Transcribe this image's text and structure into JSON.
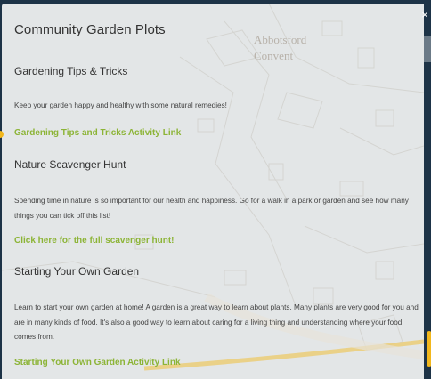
{
  "modal": {
    "title": "Community Garden Plots",
    "close_glyph": "×",
    "map_label": [
      "Abbotsford",
      "Convent"
    ]
  },
  "sections": [
    {
      "heading": "Gardening Tips & Tricks",
      "text": "Keep your garden happy and healthy with some natural remedies!",
      "link": "Gardening Tips and Tricks Activity Link"
    },
    {
      "heading": "Nature Scavenger Hunt",
      "text": "Spending time in nature is so important for our health and happiness. Go for a walk in a park or garden and see how many things you can tick off this list!",
      "link": "Click here for the full scavenger hunt!"
    },
    {
      "heading": "Starting Your Own Garden",
      "text": "Learn to start your own garden at home! A garden is a great way to learn about plants. Many plants are very good for you and are in many kinds of food. It's also a good way to learn about caring for a living thing and understanding where your food comes from.",
      "link": "Starting Your Own Garden Activity Link"
    }
  ],
  "colors": {
    "link": "#8cb436",
    "route_highlight": "#f2b71c",
    "backdrop": "#1d3347"
  }
}
